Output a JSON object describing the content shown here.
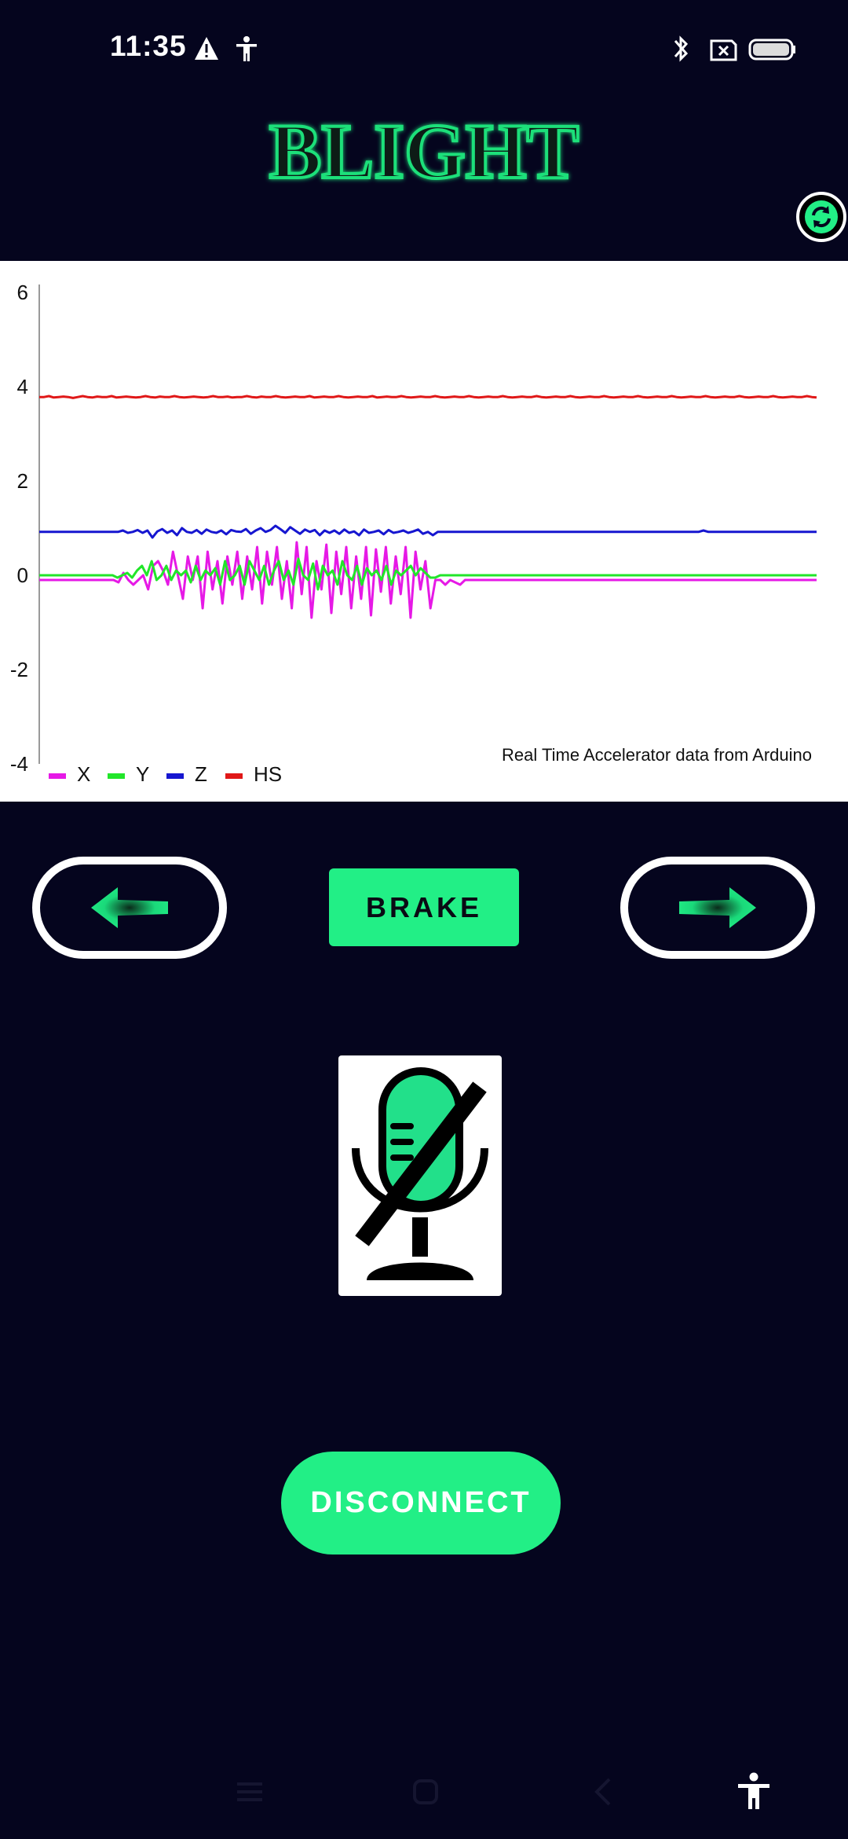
{
  "status_bar": {
    "time": "11:35",
    "icons": [
      "warning-icon",
      "accessibility-icon",
      "bluetooth-icon",
      "no-sim-icon",
      "battery-icon"
    ]
  },
  "header": {
    "app_title": "BLIGHT",
    "refresh_icon": "refresh-icon"
  },
  "chart_data": {
    "type": "line",
    "title": "",
    "description": "Real Time Accelerator data from Arduino",
    "xlabel": "",
    "ylabel": "",
    "ylim": [
      -4,
      6
    ],
    "y_ticks": [
      "6",
      "4",
      "2",
      "0",
      "-2",
      "-4"
    ],
    "grid": false,
    "legend_position": "bottom-left",
    "series": [
      {
        "name": "X",
        "color": "#e619e6",
        "values": [
          -0.1,
          -0.1,
          -0.1,
          -0.1,
          -0.1,
          -0.1,
          -0.1,
          -0.1,
          -0.1,
          -0.1,
          -0.1,
          -0.1,
          -0.1,
          -0.1,
          -0.1,
          -0.1,
          -0.15,
          0.05,
          -0.1,
          -0.2,
          -0.1,
          0.0,
          -0.3,
          0.2,
          0.3,
          0.1,
          -0.2,
          0.5,
          0.0,
          -0.5,
          0.4,
          -0.1,
          0.4,
          -0.7,
          0.5,
          -0.3,
          0.3,
          -0.6,
          0.4,
          -0.2,
          0.5,
          -0.5,
          0.4,
          -0.3,
          0.6,
          -0.6,
          0.5,
          -0.2,
          0.6,
          -0.5,
          0.3,
          -0.7,
          0.7,
          -0.4,
          0.6,
          -0.9,
          0.3,
          -0.3,
          0.65,
          -0.8,
          0.5,
          -0.4,
          0.6,
          -0.7,
          0.4,
          -0.5,
          0.6,
          -0.85,
          0.55,
          -0.35,
          0.6,
          -0.6,
          0.4,
          -0.4,
          0.6,
          -0.9,
          0.5,
          -0.3,
          0.3,
          -0.7,
          -0.1,
          -0.1,
          -0.2,
          -0.1,
          -0.15,
          -0.2,
          -0.1,
          -0.1,
          -0.1,
          -0.1,
          -0.1,
          -0.1,
          -0.1,
          -0.1,
          -0.1,
          -0.1,
          -0.1,
          -0.1,
          -0.1,
          -0.1,
          -0.1,
          -0.1,
          -0.1,
          -0.1,
          -0.1,
          -0.1,
          -0.1,
          -0.1,
          -0.1,
          -0.1,
          -0.1,
          -0.1,
          -0.1,
          -0.1,
          -0.1,
          -0.1,
          -0.1,
          -0.1,
          -0.1,
          -0.1,
          -0.1,
          -0.1,
          -0.1,
          -0.1,
          -0.1,
          -0.1,
          -0.1,
          -0.1,
          -0.1,
          -0.1,
          -0.1,
          -0.1,
          -0.1,
          -0.1,
          -0.1,
          -0.1,
          -0.1,
          -0.1,
          -0.1,
          -0.1,
          -0.1,
          -0.1,
          -0.1,
          -0.1,
          -0.1,
          -0.1,
          -0.1,
          -0.1,
          -0.1,
          -0.1,
          -0.1,
          -0.1,
          -0.1,
          -0.1,
          -0.1,
          -0.1,
          -0.1,
          -0.1
        ]
      },
      {
        "name": "Y",
        "color": "#22e62a",
        "values": [
          0.0,
          0.0,
          0.0,
          0.0,
          0.0,
          0.0,
          0.0,
          0.0,
          0.0,
          0.0,
          0.0,
          0.0,
          0.0,
          0.0,
          0.0,
          0.0,
          -0.05,
          0.0,
          0.05,
          -0.05,
          0.1,
          0.2,
          0.0,
          0.3,
          -0.1,
          0.0,
          0.2,
          -0.1,
          0.1,
          0.0,
          0.1,
          -0.15,
          0.2,
          -0.1,
          0.1,
          0.0,
          0.15,
          -0.2,
          0.3,
          -0.1,
          0.0,
          0.2,
          -0.2,
          0.3,
          0.1,
          -0.1,
          0.2,
          -0.2,
          0.1,
          0.3,
          -0.1,
          0.1,
          -0.2,
          0.35,
          0.0,
          -0.1,
          0.25,
          -0.3,
          0.2,
          0.0,
          0.1,
          -0.2,
          0.3,
          0.0,
          -0.1,
          0.2,
          -0.2,
          0.15,
          0.0,
          0.1,
          -0.1,
          0.2,
          -0.2,
          0.1,
          0.0,
          0.1,
          0.2,
          0.0,
          0.15,
          0.05,
          -0.05,
          -0.05,
          0.0,
          0.0,
          0.0,
          0.0,
          0.0,
          0.0,
          0.0,
          0.0,
          0.0,
          0.0,
          0.0,
          0.0,
          0.0,
          0.0,
          0.0,
          0.0,
          0.0,
          0.0,
          0.0,
          0.0,
          0.0,
          0.0,
          0.0,
          0.0,
          0.0,
          0.0,
          0.0,
          0.0,
          0.0,
          0.0,
          0.0,
          0.0,
          0.0,
          0.0,
          0.0,
          0.0,
          0.0,
          0.0,
          0.0,
          0.0,
          0.0,
          0.0,
          0.0,
          0.0,
          0.0,
          0.0,
          0.0,
          0.0,
          0.0,
          0.0,
          0.0,
          0.0,
          0.0,
          0.0,
          0.0,
          0.0,
          0.0,
          0.0,
          0.0,
          0.0,
          0.0,
          0.0,
          0.0,
          0.0,
          0.0,
          0.0,
          0.0,
          0.0,
          0.0,
          0.0,
          0.0,
          0.0,
          0.0,
          0.0,
          0.0,
          0.0,
          0.0,
          0.0
        ]
      },
      {
        "name": "Z",
        "color": "#1616d0",
        "values": [
          0.92,
          0.92,
          0.92,
          0.92,
          0.92,
          0.92,
          0.92,
          0.92,
          0.92,
          0.92,
          0.92,
          0.92,
          0.92,
          0.92,
          0.92,
          0.92,
          0.92,
          0.95,
          0.9,
          0.92,
          0.96,
          0.9,
          0.95,
          0.8,
          0.93,
          0.98,
          0.9,
          0.95,
          0.85,
          1.0,
          0.92,
          0.9,
          0.96,
          0.88,
          0.97,
          0.92,
          0.9,
          0.95,
          0.87,
          0.96,
          0.93,
          0.92,
          0.98,
          0.88,
          0.95,
          1.0,
          0.92,
          0.96,
          1.05,
          0.98,
          0.9,
          1.02,
          0.95,
          0.88,
          0.97,
          0.92,
          0.96,
          0.85,
          0.95,
          0.9,
          0.95,
          0.88,
          0.97,
          0.9,
          0.93,
          0.85,
          0.97,
          0.9,
          0.92,
          0.95,
          0.87,
          0.96,
          0.9,
          0.92,
          0.95,
          0.9,
          0.93,
          0.97,
          0.88,
          0.92,
          0.85,
          0.92,
          0.92,
          0.92,
          0.92,
          0.92,
          0.92,
          0.92,
          0.92,
          0.92,
          0.92,
          0.92,
          0.92,
          0.92,
          0.92,
          0.92,
          0.92,
          0.92,
          0.92,
          0.92,
          0.92,
          0.92,
          0.92,
          0.92,
          0.92,
          0.92,
          0.92,
          0.92,
          0.92,
          0.92,
          0.92,
          0.92,
          0.92,
          0.92,
          0.92,
          0.92,
          0.92,
          0.92,
          0.92,
          0.92,
          0.92,
          0.92,
          0.92,
          0.92,
          0.92,
          0.92,
          0.92,
          0.92,
          0.92,
          0.92,
          0.92,
          0.92,
          0.92,
          0.92,
          0.92,
          0.95,
          0.92,
          0.92,
          0.92,
          0.92,
          0.92,
          0.92,
          0.92,
          0.92,
          0.92,
          0.92,
          0.92,
          0.92,
          0.92,
          0.92,
          0.92,
          0.92,
          0.92,
          0.92,
          0.92,
          0.92,
          0.92,
          0.92,
          0.92
        ]
      },
      {
        "name": "HS",
        "color": "#e01818",
        "values": [
          3.78,
          3.78,
          3.8,
          3.77,
          3.78,
          3.79,
          3.78,
          3.76,
          3.78,
          3.8,
          3.78,
          3.77,
          3.79,
          3.78,
          3.78,
          3.8,
          3.77,
          3.78,
          3.79,
          3.78,
          3.77,
          3.78,
          3.8,
          3.78,
          3.77,
          3.79,
          3.78,
          3.78,
          3.8,
          3.78,
          3.77,
          3.78,
          3.79,
          3.78,
          3.77,
          3.78,
          3.8,
          3.78,
          3.78,
          3.79,
          3.77,
          3.78,
          3.78,
          3.8,
          3.78,
          3.77,
          3.79,
          3.78,
          3.78,
          3.8,
          3.78,
          3.77,
          3.78,
          3.79,
          3.78,
          3.78,
          3.8,
          3.77,
          3.78,
          3.79,
          3.78,
          3.78,
          3.8,
          3.78,
          3.77,
          3.78,
          3.79,
          3.78,
          3.78,
          3.8,
          3.77,
          3.78,
          3.79,
          3.78,
          3.78,
          3.8,
          3.78,
          3.77,
          3.78,
          3.79,
          3.78,
          3.78,
          3.8,
          3.78,
          3.77,
          3.78,
          3.79,
          3.78,
          3.78,
          3.8,
          3.78,
          3.77,
          3.78,
          3.79,
          3.78,
          3.78,
          3.8,
          3.78,
          3.77,
          3.78,
          3.79,
          3.78,
          3.78,
          3.8,
          3.78,
          3.77,
          3.78,
          3.79,
          3.78,
          3.78,
          3.8,
          3.78,
          3.77,
          3.78,
          3.79,
          3.78,
          3.78,
          3.8,
          3.78,
          3.77,
          3.78,
          3.79,
          3.78,
          3.78,
          3.8,
          3.78,
          3.77,
          3.78,
          3.79,
          3.78,
          3.78,
          3.8,
          3.78,
          3.77,
          3.78,
          3.79,
          3.78,
          3.78,
          3.8,
          3.78,
          3.77,
          3.78,
          3.79,
          3.78,
          3.78,
          3.8,
          3.78,
          3.77,
          3.78,
          3.79,
          3.78,
          3.78,
          3.8,
          3.78,
          3.77,
          3.78,
          3.79,
          3.78,
          3.78,
          3.8,
          3.78,
          3.77
        ]
      }
    ]
  },
  "controls": {
    "left_icon": "left-arrow-icon",
    "right_icon": "right-arrow-icon",
    "brake_label": "BRAKE",
    "mic_icon": "microphone-muted-icon",
    "disconnect_label": "DISCONNECT"
  },
  "colors": {
    "background": "#05051e",
    "accent": "#22ef86",
    "logo_glow": "#1fe07a"
  },
  "nav_bar": {
    "icons": [
      "menu-icon",
      "home-icon",
      "back-icon",
      "accessibility-icon"
    ]
  }
}
